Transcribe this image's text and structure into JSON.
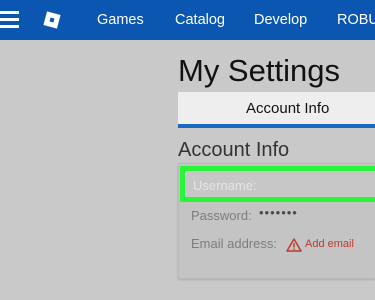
{
  "nav": {
    "menu_icon": "hamburger-menu-icon",
    "logo_icon": "roblox-logo-icon",
    "links": [
      "Games",
      "Catalog",
      "Develop",
      "ROBUX"
    ]
  },
  "page": {
    "title": "My Settings",
    "tab_label": "Account Info",
    "section_heading": "Account Info"
  },
  "account": {
    "username_label": "Username:",
    "password_label": "Password:",
    "password_value": "•••••••",
    "email_label": "Email address:",
    "warning_icon": "warning-triangle-icon",
    "add_email_label": "Add email"
  },
  "colors": {
    "nav_background": "#0a56b0",
    "highlight": "#2af53b",
    "tab_underline": "#1a69c5",
    "warning": "#c0392b"
  }
}
